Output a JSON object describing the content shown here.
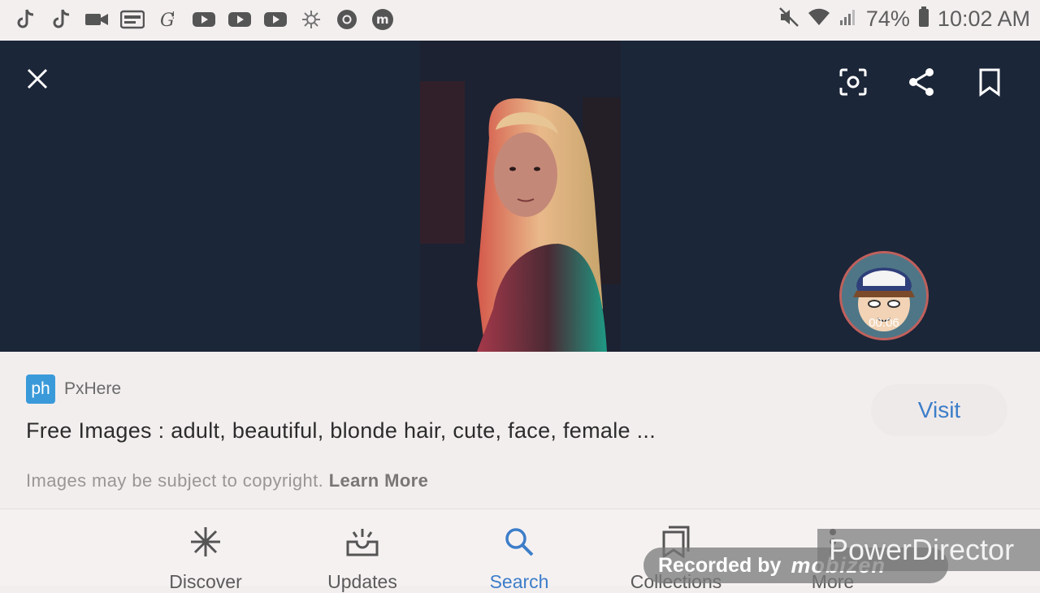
{
  "status_bar": {
    "left_icons": [
      "tiktok-icon",
      "tiktok-icon",
      "video-camera-icon",
      "news-icon",
      "gift-g-icon",
      "youtube-icon",
      "youtube-icon",
      "youtube-icon",
      "snowflake-icon",
      "chrome-icon",
      "mobizen-m-icon"
    ],
    "battery": "74%",
    "time": "10:02 AM"
  },
  "viewer": {
    "overlay_timer": "00:06"
  },
  "result": {
    "source_logo": "ph",
    "source_name": "PxHere",
    "title": "Free Images : adult, beautiful, blonde hair, cute, face, female ...",
    "visit_label": "Visit",
    "copyright_text": "Images may be subject to copyright.",
    "learn_more": "Learn More"
  },
  "nav": {
    "items": [
      {
        "label": "Discover",
        "icon": "asterisk-icon"
      },
      {
        "label": "Updates",
        "icon": "inbox-icon"
      },
      {
        "label": "Search",
        "icon": "search-icon",
        "active": true
      },
      {
        "label": "Collections",
        "icon": "collections-icon"
      },
      {
        "label": "More",
        "icon": "more-icon"
      }
    ]
  },
  "watermarks": {
    "recorded_by": "Recorded by",
    "recorder_brand": "mobizen",
    "editor": "PowerDirector"
  },
  "colors": {
    "accent": "#3c7ec9",
    "viewer_bg": "#1b2638",
    "page_bg": "#f3eeee"
  }
}
